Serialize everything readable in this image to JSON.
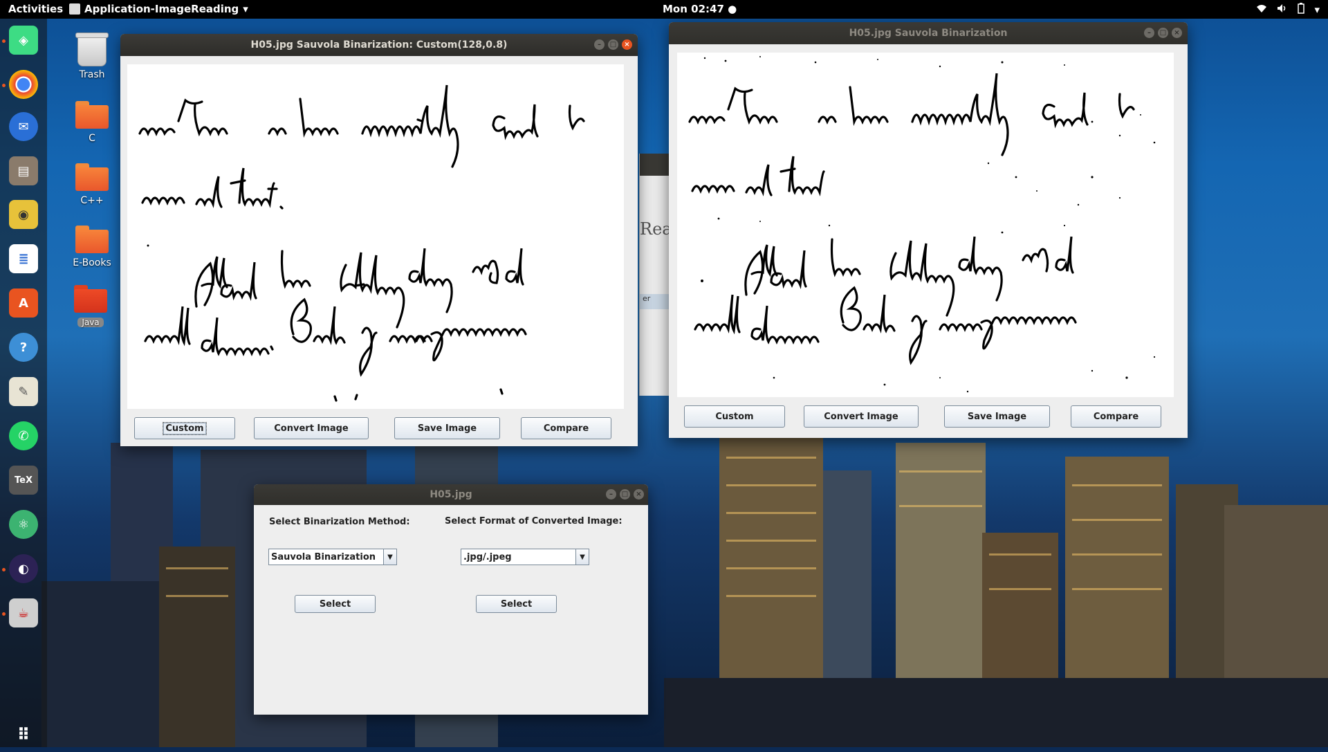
{
  "topbar": {
    "activities": "Activities",
    "app_name": "Application-ImageReading",
    "clock": "Mon 02:47 ●"
  },
  "desktop_icons": [
    {
      "label": "Trash"
    },
    {
      "label": "C"
    },
    {
      "label": "C++"
    },
    {
      "label": "E-Books"
    },
    {
      "label": "Java"
    }
  ],
  "dock": [
    {
      "name": "android-studio-icon",
      "color": "#3ddc84"
    },
    {
      "name": "chrome-icon",
      "color": "#4285f4"
    },
    {
      "name": "thunderbird-icon",
      "color": "#2a6fd6"
    },
    {
      "name": "files-icon",
      "color": "#8a7b6b"
    },
    {
      "name": "rhythmbox-icon",
      "color": "#e7c23a"
    },
    {
      "name": "libreoffice-writer-icon",
      "color": "#2b6ad1"
    },
    {
      "name": "software-center-icon",
      "color": "#e95420"
    },
    {
      "name": "help-icon",
      "color": "#3d8fd6"
    },
    {
      "name": "text-editor-icon",
      "color": "#e8e4d4"
    },
    {
      "name": "whatsapp-icon",
      "color": "#25d366"
    },
    {
      "name": "texmaker-icon",
      "color": "#555555"
    },
    {
      "name": "atom-icon",
      "color": "#3cb371"
    },
    {
      "name": "eclipse-icon",
      "color": "#2c2255"
    },
    {
      "name": "java-app-icon",
      "color": "#cfcfcf"
    },
    {
      "name": "show-apps-icon",
      "color": "#000000"
    }
  ],
  "window_custom": {
    "title": "H05.jpg Sauvola Binarization: Custom(128,0.8)",
    "buttons": [
      "Custom",
      "Convert Image",
      "Save Image",
      "Compare"
    ]
  },
  "window_default": {
    "title": "H05.jpg Sauvola Binarization",
    "buttons": [
      "Custom",
      "Convert Image",
      "Save Image",
      "Compare"
    ]
  },
  "background_window": {
    "partial_text": "Rea",
    "partial_button": "er"
  },
  "window_selector": {
    "title": "H05.jpg",
    "method_label": "Select Binarization Method:",
    "format_label": "Select Format of Converted Image:",
    "method_value": "Sauvola Binarization",
    "format_value": ".jpg/.jpeg",
    "select_button": "Select"
  }
}
